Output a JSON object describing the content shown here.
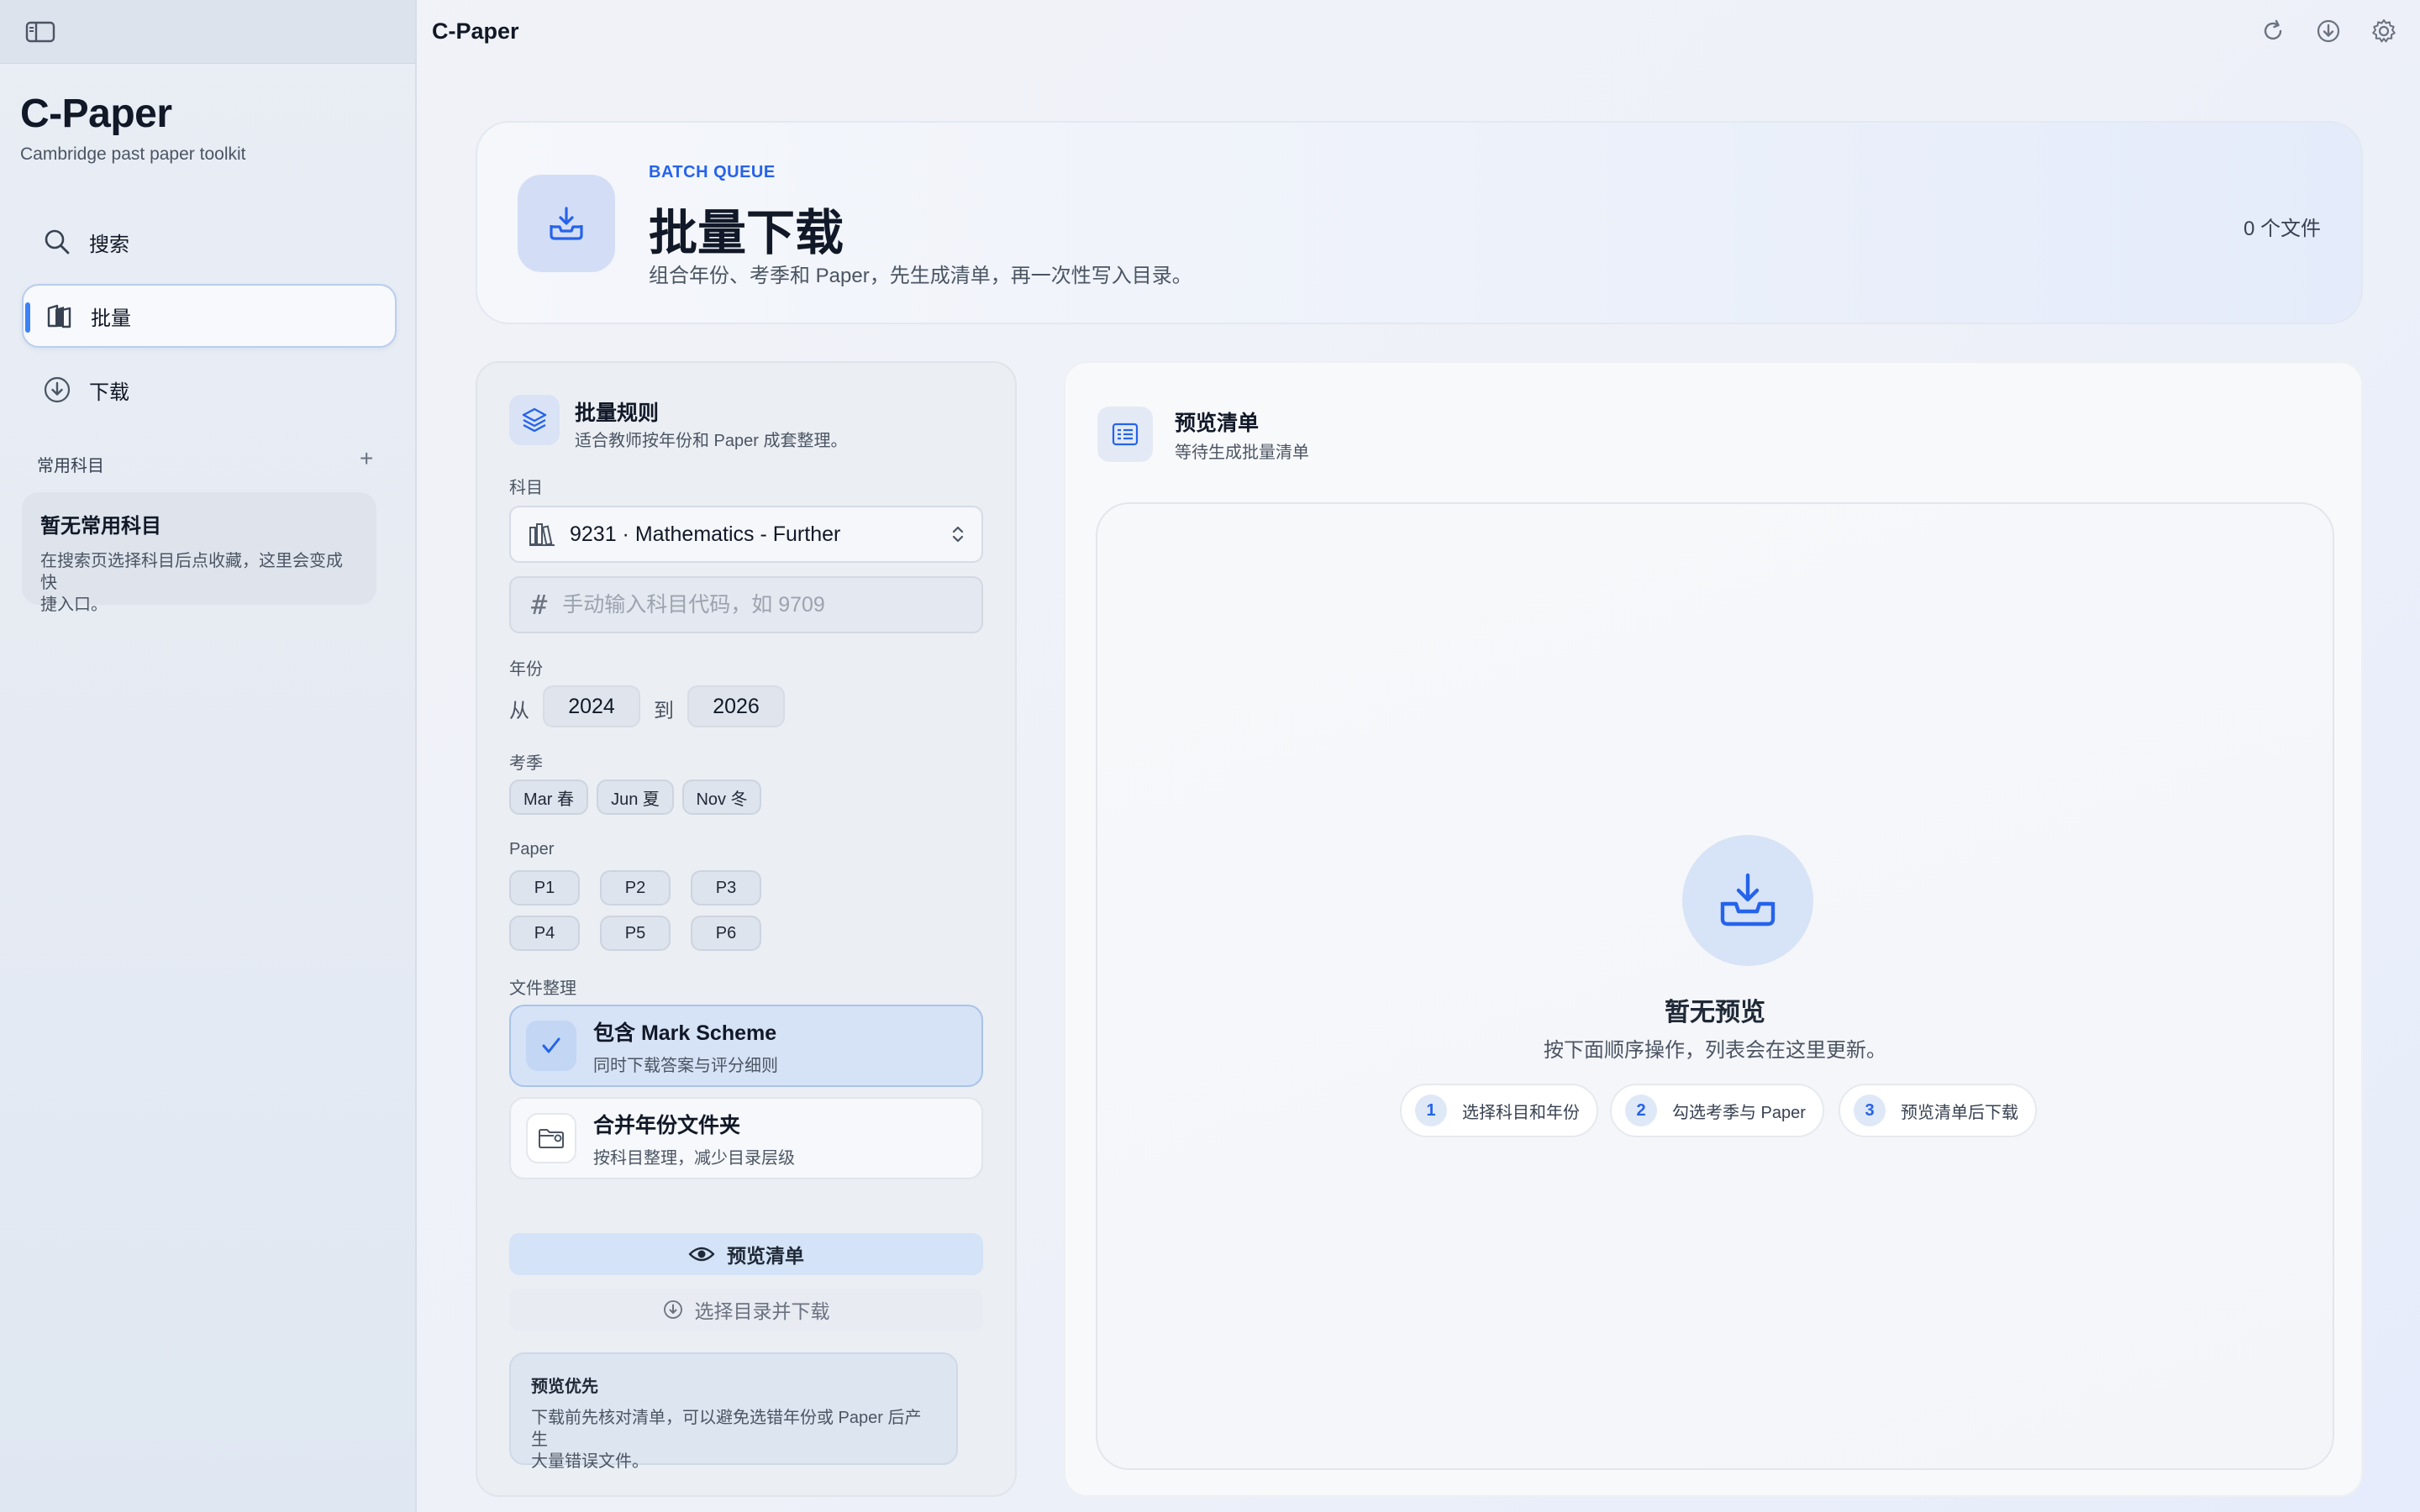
{
  "sidebar": {
    "app_name": "C-Paper",
    "app_subtitle": "Cambridge past paper toolkit",
    "nav": [
      {
        "label": "搜索",
        "icon": "search-icon"
      },
      {
        "label": "批量",
        "icon": "batch-icon",
        "active": true
      },
      {
        "label": "下载",
        "icon": "download-icon"
      }
    ],
    "favorites": {
      "heading": "常用科目",
      "add": "+",
      "empty_title": "暂无常用科目",
      "empty_desc_1": "在搜索页选择科目后点收藏，这里会变成快",
      "empty_desc_2": "捷入口。"
    }
  },
  "toolbar": {
    "title": "C-Paper",
    "icons": [
      "refresh-icon",
      "download-circle-icon",
      "gear-icon"
    ]
  },
  "hero": {
    "kicker": "BATCH QUEUE",
    "title": "批量下载",
    "subtitle": "组合年份、考季和 Paper，先生成清单，再一次性写入目录。",
    "count": "0 个文件"
  },
  "rules": {
    "title": "批量规则",
    "subtitle": "适合教师按年份和 Paper 成套整理。",
    "subject_label": "科目",
    "subject_value": "9231 · Mathematics - Further",
    "code_placeholder": "手动输入科目代码，如 9709",
    "year_label": "年份",
    "from": "从",
    "to": "到",
    "year_from": "2024",
    "year_to": "2026",
    "season_label": "考季",
    "seasons": [
      "Mar 春",
      "Jun 夏",
      "Nov 冬"
    ],
    "paper_label": "Paper",
    "papers": [
      "P1",
      "P2",
      "P3",
      "P4",
      "P5",
      "P6"
    ],
    "organize_label": "文件整理",
    "mark_scheme": {
      "title": "包含 Mark Scheme",
      "desc": "同时下载答案与评分细则",
      "checked": true
    },
    "merge_year": {
      "title": "合并年份文件夹",
      "desc": "按科目整理，减少目录层级",
      "checked": false
    },
    "preview_button": "预览清单",
    "download_button": "选择目录并下载",
    "tip_title": "预览优先",
    "tip_desc_1": "下载前先核对清单，可以避免选错年份或 Paper 后产生",
    "tip_desc_2": "大量错误文件。"
  },
  "preview": {
    "title": "预览清单",
    "subtitle": "等待生成批量清单",
    "empty_title": "暂无预览",
    "empty_sub": "按下面顺序操作，列表会在这里更新。",
    "steps": [
      {
        "num": "1",
        "label": "选择科目和年份"
      },
      {
        "num": "2",
        "label": "勾选考季与 Paper"
      },
      {
        "num": "3",
        "label": "预览清单后下载"
      }
    ]
  },
  "colors": {
    "accent": "#2563eb",
    "active_indicator": "#3b82f6"
  }
}
